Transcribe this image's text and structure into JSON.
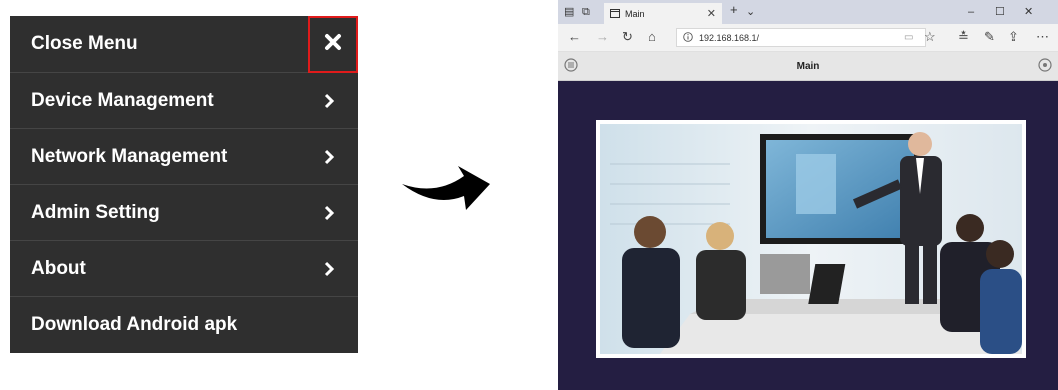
{
  "menu": {
    "items": [
      {
        "label": "Close Menu",
        "icon": "close-icon"
      },
      {
        "label": "Device Management",
        "icon": "chevron-right-icon"
      },
      {
        "label": "Network Management",
        "icon": "chevron-right-icon"
      },
      {
        "label": "Admin Setting",
        "icon": "chevron-right-icon"
      },
      {
        "label": "About",
        "icon": "chevron-right-icon"
      },
      {
        "label": "Download Android apk"
      }
    ],
    "highlight_color": "#e01b1b"
  },
  "browser": {
    "tab_title": "Main",
    "url": "192.168.168.1/",
    "page_title": "Main",
    "background_color": "#241e42"
  }
}
